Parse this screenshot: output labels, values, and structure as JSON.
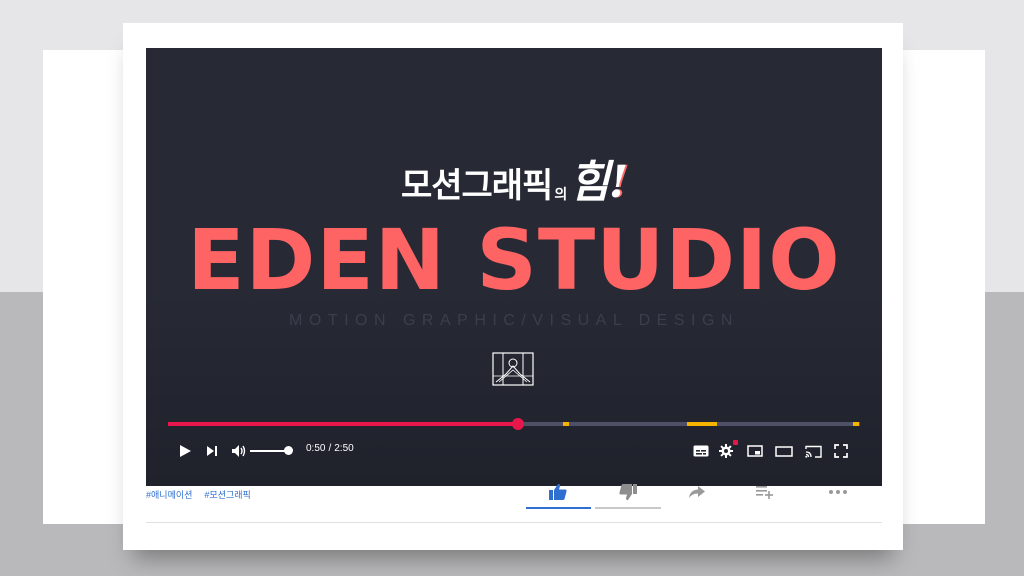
{
  "video": {
    "title_korean": "모션그래픽",
    "title_particle": "의",
    "title_emphasis": "힘",
    "title_exclaim": "!",
    "brand": "EDEN STUDIO",
    "tagline": "MOTION GRAPHIC/VISUAL DESIGN"
  },
  "player": {
    "current_time": "0:50",
    "duration": "2:50",
    "time_separator": "/",
    "progress_fraction": 0.506,
    "volume_fraction": 1.0,
    "chapter_markers": [
      0.571,
      0.772,
      0.99
    ]
  },
  "tags": [
    "#애니메이션",
    "#모션그래픽"
  ],
  "colors": {
    "progress_played": "#e8174b",
    "marker": "#f5b400",
    "brand": "#ff6464",
    "tag_link": "#2f6fd0"
  },
  "icons": {
    "play": "play-icon",
    "next": "next-icon",
    "volume": "volume-icon",
    "subtitles": "subtitles-icon",
    "settings": "settings-icon",
    "miniplayer": "miniplayer-icon",
    "theater": "theater-icon",
    "cast": "cast-icon",
    "fullscreen": "fullscreen-icon",
    "like": "thumbs-up-icon",
    "dislike": "thumbs-down-icon",
    "share": "share-icon",
    "save": "playlist-add-icon",
    "more": "more-icon"
  }
}
